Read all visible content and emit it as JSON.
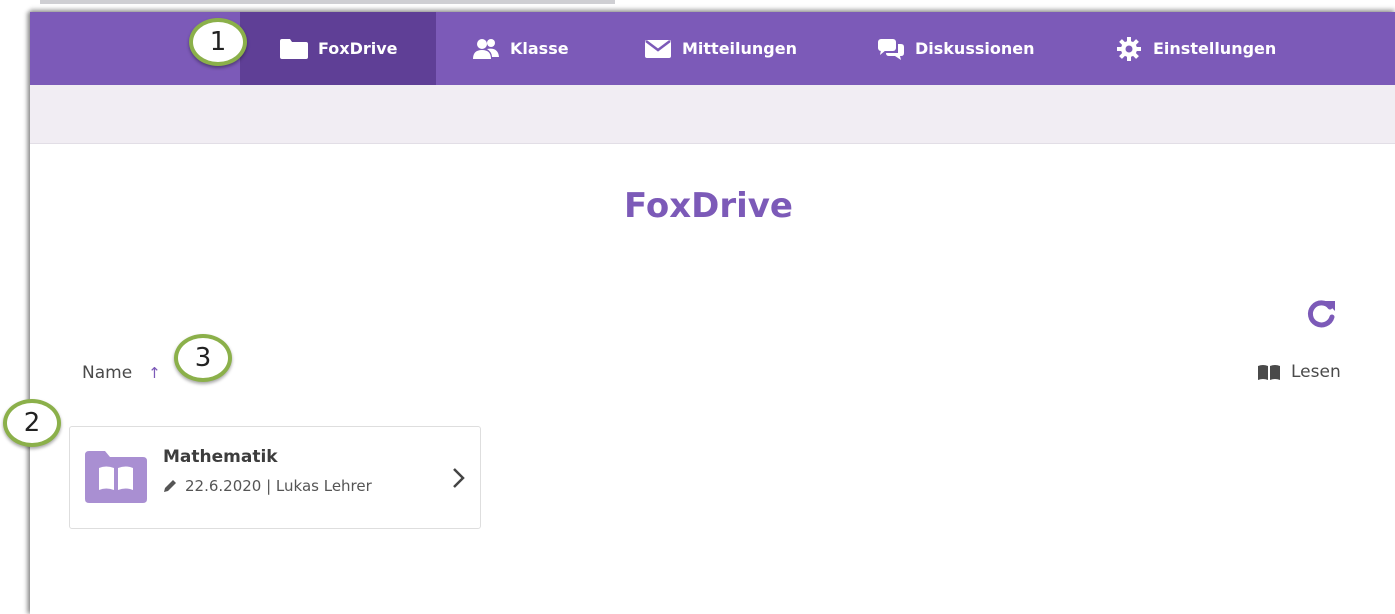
{
  "nav": {
    "items": [
      {
        "label": "FoxDrive",
        "icon": "folder-icon",
        "active": true
      },
      {
        "label": "Klasse",
        "icon": "users-icon",
        "active": false
      },
      {
        "label": "Mitteilungen",
        "icon": "envelope-icon",
        "active": false
      },
      {
        "label": "Diskussionen",
        "icon": "chat-icon",
        "active": false
      },
      {
        "label": "Einstellungen",
        "icon": "gear-icon",
        "active": false
      }
    ]
  },
  "page": {
    "title": "FoxDrive"
  },
  "toolbar": {
    "sort_label": "Name",
    "sort_arrow": "↑",
    "read_label": "Lesen",
    "refresh_icon": "refresh-icon"
  },
  "folders": [
    {
      "name": "Mathematik",
      "meta": "22.6.2020 | Lukas Lehrer",
      "icon": "book-folder-icon"
    }
  ],
  "callouts": [
    "1",
    "2",
    "3"
  ],
  "colors": {
    "accent": "#7c5ab8",
    "accent_dark": "#5f3f96",
    "callout_border": "#8bb04a"
  }
}
